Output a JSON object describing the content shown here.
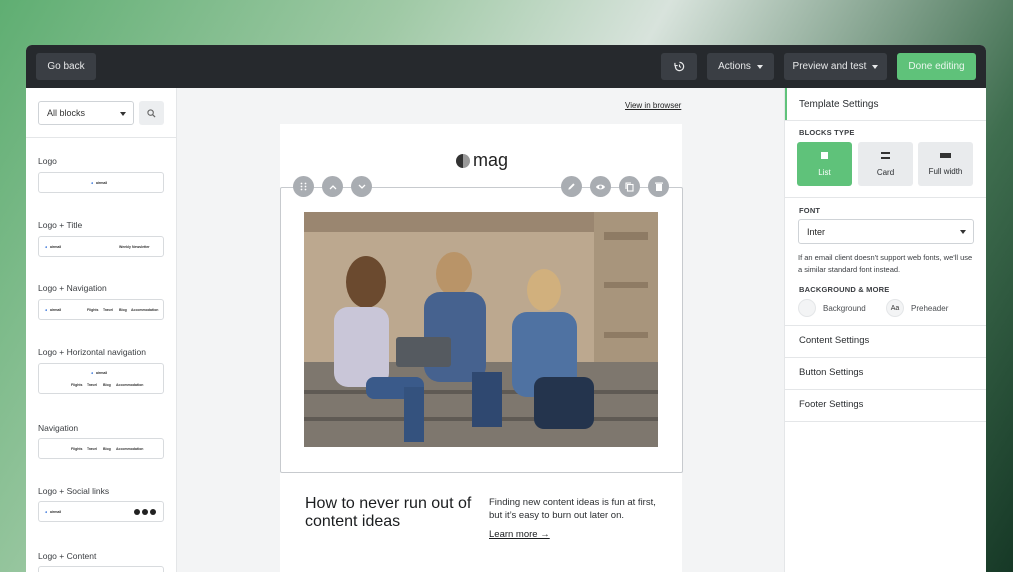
{
  "topbar": {
    "go_back": "Go back",
    "actions": "Actions",
    "preview": "Preview and test",
    "done": "Done editing",
    "history_icon": "history-icon"
  },
  "sidebar": {
    "filter": "All blocks",
    "search_icon": "search-icon",
    "blocks": [
      {
        "label": "Logo"
      },
      {
        "label": "Logo + Title",
        "extra": "Weekly Newsletter"
      },
      {
        "label": "Logo + Navigation"
      },
      {
        "label": "Logo + Horizontal navigation"
      },
      {
        "label": "Navigation"
      },
      {
        "label": "Logo + Social links"
      },
      {
        "label": "Logo + Content"
      }
    ],
    "thumb_brand": "airmail",
    "thumb_nav": [
      "Flights",
      "Travel",
      "Blog",
      "Accommodation"
    ]
  },
  "canvas": {
    "view_in_browser": "View in browser",
    "logo_text": "mag",
    "headline": "How to never run out of content ideas",
    "body": "Finding new content ideas is fun at first, but it’s easy to burn out later on.",
    "cta": "Learn more →"
  },
  "settings": {
    "title": "Template Settings",
    "blocks_type_label": "BLOCKS TYPE",
    "types": [
      "List",
      "Card",
      "Full width"
    ],
    "active_type": "List",
    "font_label": "FONT",
    "font_value": "Inter",
    "font_note": "If an email client doesn't support web fonts, we'll use a similar standard font instead.",
    "background_label": "BACKGROUND & MORE",
    "background": "Background",
    "preheader": "Preheader",
    "preheader_glyph": "Aa",
    "sections": [
      "Content Settings",
      "Button Settings",
      "Footer Settings"
    ]
  },
  "colors": {
    "accent": "#5fc27a",
    "topbar": "#26292d"
  }
}
